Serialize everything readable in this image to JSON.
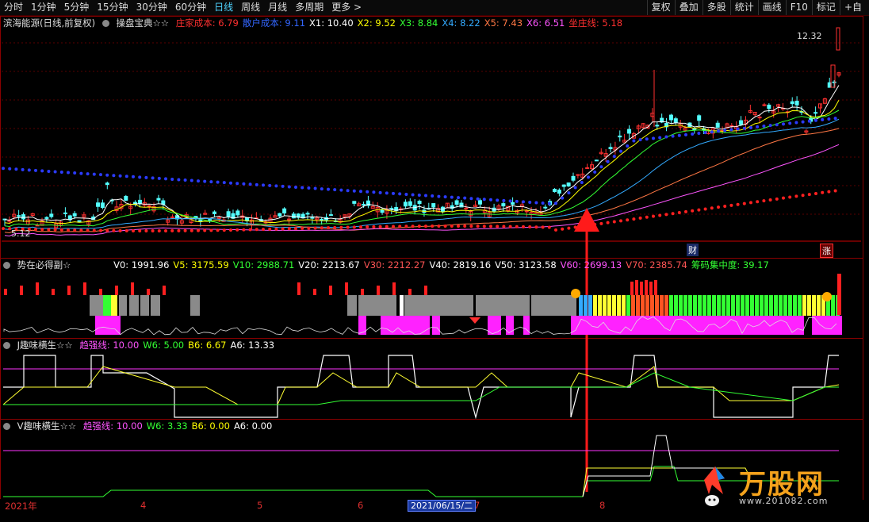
{
  "toolbar": {
    "periods": [
      "分时",
      "1分钟",
      "5分钟",
      "15分钟",
      "30分钟",
      "60分钟",
      "日线",
      "周线",
      "月线",
      "多周期",
      "更多 >"
    ],
    "active_index": 6,
    "tools": [
      "复权",
      "叠加",
      "多股",
      "统计",
      "画线",
      "F10",
      "标记",
      "+自"
    ]
  },
  "main_panel": {
    "title": "滨海能源(日线,前复权)",
    "indicator": "操盘宝典☆☆",
    "fields": [
      {
        "label": "庄家成本:",
        "value": "6.79",
        "color": "#ff3030"
      },
      {
        "label": "散户成本:",
        "value": "9.11",
        "color": "#3366ff"
      },
      {
        "label": "X1:",
        "value": "10.40",
        "color": "#ffffff"
      },
      {
        "label": "X2:",
        "value": "9.52",
        "color": "#ffff00"
      },
      {
        "label": "X3:",
        "value": "8.84",
        "color": "#33ff33"
      },
      {
        "label": "X4:",
        "value": "8.22",
        "color": "#33aaff"
      },
      {
        "label": "X5:",
        "value": "7.43",
        "color": "#ff7744"
      },
      {
        "label": "X6:",
        "value": "6.51",
        "color": "#ff55ff"
      },
      {
        "label": "坐庄线:",
        "value": "5.18",
        "color": "#ff3030"
      }
    ],
    "high_price": "12.32",
    "low_price": "5.12",
    "mark_cai": "财",
    "mark_zhang": "涨"
  },
  "panel2": {
    "name": "势在必得副☆",
    "fields": [
      {
        "label": "V0:",
        "value": "1991.96",
        "color": "#ffffff"
      },
      {
        "label": "V5:",
        "value": "3175.59",
        "color": "#ffff00"
      },
      {
        "label": "V10:",
        "value": "2988.71",
        "color": "#33ff33"
      },
      {
        "label": "V20:",
        "value": "2213.67",
        "color": "#ffffff"
      },
      {
        "label": "V30:",
        "value": "2212.27",
        "color": "#ff5555"
      },
      {
        "label": "V40:",
        "value": "2819.16",
        "color": "#ffffff"
      },
      {
        "label": "V50:",
        "value": "3123.58",
        "color": "#ffffff"
      },
      {
        "label": "V60:",
        "value": "2699.13",
        "color": "#ff55ff"
      },
      {
        "label": "V70:",
        "value": "2385.74",
        "color": "#ff5555"
      },
      {
        "label": "筹码集中度:",
        "value": "39.17",
        "color": "#33ff33"
      }
    ]
  },
  "panel3": {
    "name": "J趣味横生☆☆",
    "fields": [
      {
        "label": "趋强线:",
        "value": "10.00",
        "color": "#ff55ff"
      },
      {
        "label": "W6:",
        "value": "5.00",
        "color": "#33ff33"
      },
      {
        "label": "B6:",
        "value": "6.67",
        "color": "#ffff00"
      },
      {
        "label": "A6:",
        "value": "13.33",
        "color": "#ffffff"
      }
    ]
  },
  "panel4": {
    "name": "V趣味横生☆☆",
    "fields": [
      {
        "label": "趋强线:",
        "value": "10.00",
        "color": "#ff55ff"
      },
      {
        "label": "W6:",
        "value": "3.33",
        "color": "#33ff33"
      },
      {
        "label": "B6:",
        "value": "0.00",
        "color": "#ffff00"
      },
      {
        "label": "A6:",
        "value": "0.00",
        "color": "#ffffff"
      }
    ]
  },
  "time_axis": {
    "labels": [
      "2021年",
      "4",
      "5",
      "6",
      "7",
      "8"
    ],
    "cursor_date": "2021/06/15/二"
  },
  "watermark": {
    "name": "万股网",
    "url": "www.201082.com"
  }
}
